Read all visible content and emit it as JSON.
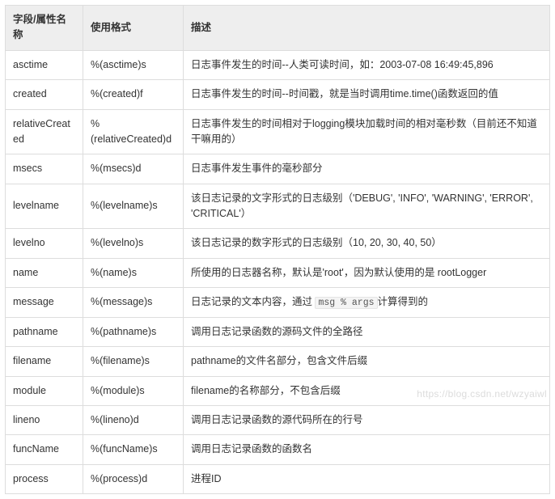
{
  "headers": {
    "col1": "字段/属性名称",
    "col2": "使用格式",
    "col3": "描述"
  },
  "rows": [
    {
      "name": "asctime",
      "fmt": "%(asctime)s",
      "desc": "日志事件发生的时间--人类可读时间，如：2003-07-08 16:49:45,896"
    },
    {
      "name": "created",
      "fmt": "%(created)f",
      "desc": "日志事件发生的时间--时间戳，就是当时调用time.time()函数返回的值"
    },
    {
      "name": "relativeCreated",
      "fmt": "%(relativeCreated)d",
      "desc": "日志事件发生的时间相对于logging模块加载时间的相对毫秒数（目前还不知道干嘛用的）"
    },
    {
      "name": "msecs",
      "fmt": "%(msecs)d",
      "desc": "日志事件发生事件的毫秒部分"
    },
    {
      "name": "levelname",
      "fmt": "%(levelname)s",
      "desc": "该日志记录的文字形式的日志级别（'DEBUG', 'INFO', 'WARNING', 'ERROR', 'CRITICAL'）"
    },
    {
      "name": "levelno",
      "fmt": "%(levelno)s",
      "desc": "该日志记录的数字形式的日志级别（10, 20, 30, 40, 50）"
    },
    {
      "name": "name",
      "fmt": "%(name)s",
      "desc": "所使用的日志器名称，默认是'root'，因为默认使用的是 rootLogger"
    },
    {
      "name": "message",
      "fmt": "%(message)s",
      "desc_pre": "日志记录的文本内容，通过 ",
      "code": "msg % args",
      "desc_post": "计算得到的"
    },
    {
      "name": "pathname",
      "fmt": "%(pathname)s",
      "desc": "调用日志记录函数的源码文件的全路径"
    },
    {
      "name": "filename",
      "fmt": "%(filename)s",
      "desc": "pathname的文件名部分，包含文件后缀"
    },
    {
      "name": "module",
      "fmt": "%(module)s",
      "desc": "filename的名称部分，不包含后缀"
    },
    {
      "name": "lineno",
      "fmt": "%(lineno)d",
      "desc": "调用日志记录函数的源代码所在的行号"
    },
    {
      "name": "funcName",
      "fmt": "%(funcName)s",
      "desc": "调用日志记录函数的函数名"
    },
    {
      "name": "process",
      "fmt": "%(process)d",
      "desc": "进程ID"
    }
  ],
  "watermark": "https://blog.csdn.net/wzyaiwl"
}
